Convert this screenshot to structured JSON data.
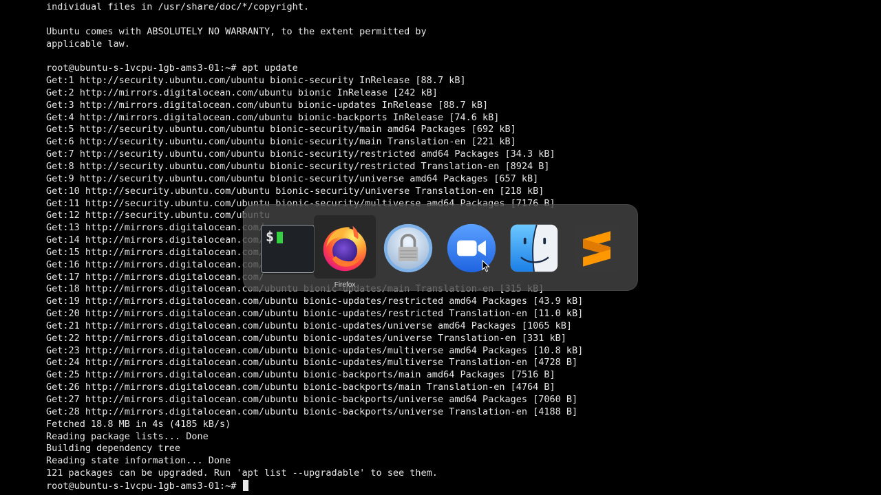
{
  "terminal": {
    "lines": [
      "individual files in /usr/share/doc/*/copyright.",
      "",
      "Ubuntu comes with ABSOLUTELY NO WARRANTY, to the extent permitted by",
      "applicable law.",
      "",
      "root@ubuntu-s-1vcpu-1gb-ams3-01:~# apt update",
      "Get:1 http://security.ubuntu.com/ubuntu bionic-security InRelease [88.7 kB]",
      "Get:2 http://mirrors.digitalocean.com/ubuntu bionic InRelease [242 kB]",
      "Get:3 http://mirrors.digitalocean.com/ubuntu bionic-updates InRelease [88.7 kB]",
      "Get:4 http://mirrors.digitalocean.com/ubuntu bionic-backports InRelease [74.6 kB]",
      "Get:5 http://security.ubuntu.com/ubuntu bionic-security/main amd64 Packages [692 kB]",
      "Get:6 http://security.ubuntu.com/ubuntu bionic-security/main Translation-en [221 kB]",
      "Get:7 http://security.ubuntu.com/ubuntu bionic-security/restricted amd64 Packages [34.3 kB]",
      "Get:8 http://security.ubuntu.com/ubuntu bionic-security/restricted Translation-en [8924 B]",
      "Get:9 http://security.ubuntu.com/ubuntu bionic-security/universe amd64 Packages [657 kB]",
      "Get:10 http://security.ubuntu.com/ubuntu bionic-security/universe Translation-en [218 kB]",
      "Get:11 http://security.ubuntu.com/ubuntu bionic-security/multiverse amd64 Packages [7176 B]",
      "Get:12 http://security.ubuntu.com/ubuntu",
      "Get:13 http://mirrors.digitalocean.com/",
      "Get:14 http://mirrors.digitalocean.com/",
      "Get:15 http://mirrors.digitalocean.com/",
      "Get:16 http://mirrors.digitalocean.com/",
      "Get:17 http://mirrors.digitalocean.com/",
      "Get:18 http://mirrors.digitalocean.com/ubuntu bionic-updates/main Translation-en [315 kB]",
      "Get:19 http://mirrors.digitalocean.com/ubuntu bionic-updates/restricted amd64 Packages [43.9 kB]",
      "Get:20 http://mirrors.digitalocean.com/ubuntu bionic-updates/restricted Translation-en [11.0 kB]",
      "Get:21 http://mirrors.digitalocean.com/ubuntu bionic-updates/universe amd64 Packages [1065 kB]",
      "Get:22 http://mirrors.digitalocean.com/ubuntu bionic-updates/universe Translation-en [331 kB]",
      "Get:23 http://mirrors.digitalocean.com/ubuntu bionic-updates/multiverse amd64 Packages [10.8 kB]",
      "Get:24 http://mirrors.digitalocean.com/ubuntu bionic-updates/multiverse Translation-en [4728 B]",
      "Get:25 http://mirrors.digitalocean.com/ubuntu bionic-backports/main amd64 Packages [7516 B]",
      "Get:26 http://mirrors.digitalocean.com/ubuntu bionic-backports/main Translation-en [4764 B]",
      "Get:27 http://mirrors.digitalocean.com/ubuntu bionic-backports/universe amd64 Packages [7060 B]",
      "Get:28 http://mirrors.digitalocean.com/ubuntu bionic-backports/universe Translation-en [4188 B]",
      "Fetched 18.8 MB in 4s (4185 kB/s)",
      "Reading package lists... Done",
      "Building dependency tree",
      "Reading state information... Done",
      "121 packages can be upgraded. Run 'apt list --upgradable' to see them."
    ],
    "prompt": "root@ubuntu-s-1vcpu-1gb-ams3-01:~# "
  },
  "app_switcher": {
    "apps": [
      {
        "name": "Terminal",
        "icon": "terminal-icon"
      },
      {
        "name": "Firefox",
        "icon": "firefox-icon"
      },
      {
        "name": "",
        "icon": "keychain-access-icon"
      },
      {
        "name": "",
        "icon": "zoom-icon"
      },
      {
        "name": "",
        "icon": "finder-icon"
      },
      {
        "name": "",
        "icon": "sublime-text-icon"
      }
    ],
    "selected_label": "Firefox"
  },
  "colors": {
    "terminal_bg": "#000000",
    "terminal_fg": "#e8e8e8",
    "switcher_bg": "#464646"
  }
}
